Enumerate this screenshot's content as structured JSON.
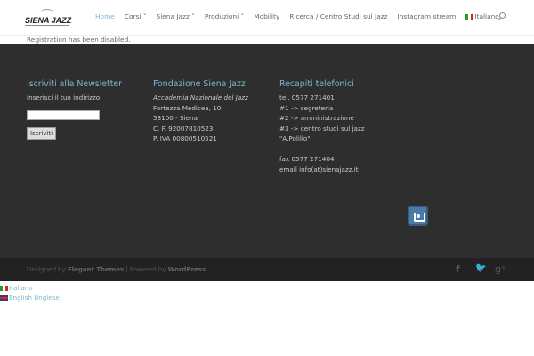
{
  "header": {
    "logo": "SIENA JAZZ",
    "nav": [
      {
        "label": "Home"
      },
      {
        "label": "Corsi ˅"
      },
      {
        "label": "Siena Jazz ˅"
      },
      {
        "label": "Produzioni ˅"
      },
      {
        "label": "Mobility"
      },
      {
        "label": "Ricerca / Centro Studi sul Jazz"
      },
      {
        "label": "Instagram stream"
      }
    ],
    "lang": "Italiano"
  },
  "notice": "Registration has been disabled.",
  "footer": {
    "newsletter": {
      "title": "Iscriviti alla Newsletter",
      "label": "Inserisci il tuo indirizzo:",
      "button": "Iscriviti",
      "value": ""
    },
    "fondazione": {
      "title": "Fondazione Siena Jazz",
      "lines": [
        "Accademia Nazionale del Jazz",
        "Fortezza Medicea, 10",
        "53100 - Siena",
        "C. F. 92007810523",
        "P. IVA 00800510521"
      ]
    },
    "recapiti": {
      "title": "Recapiti telefonici",
      "lines": [
        "tel. 0577 271401",
        "#1 -> segreteria",
        "#2 -> amministrazione",
        "#3 -> centro studi sul jazz",
        "\"A.Polillo\"",
        "",
        "fax 0577 271404",
        "email info(at)sienajazz.it"
      ]
    }
  },
  "bottom": {
    "designed": "Designed by ",
    "et": "Elegant Themes",
    "powered": " | Powered by ",
    "wp": "WordPress"
  },
  "langs": [
    "Italiano",
    "English (Inglese)"
  ]
}
